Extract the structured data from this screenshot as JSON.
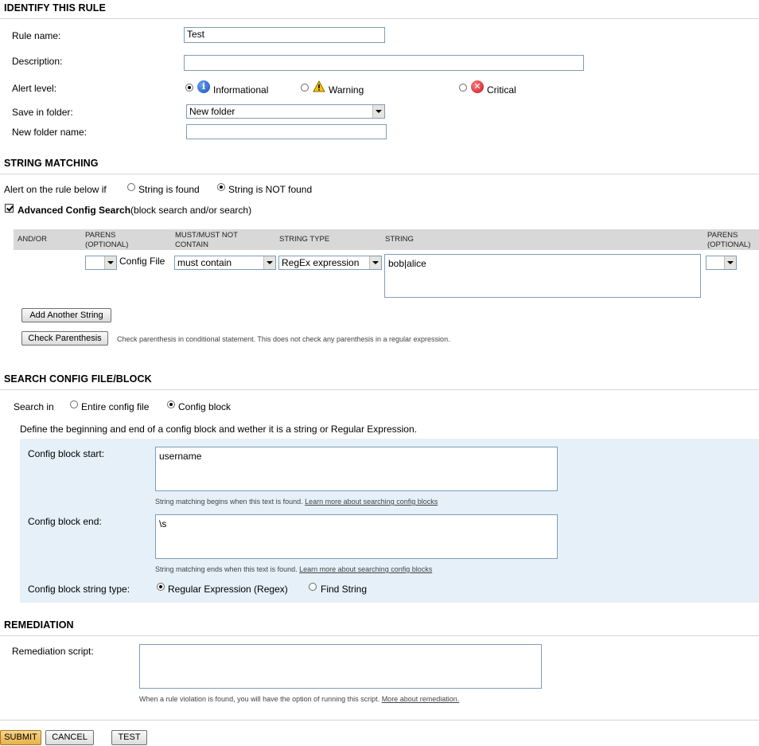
{
  "identify": {
    "title": "IDENTIFY THIS RULE",
    "rule_name_label": "Rule name:",
    "rule_name_value": "Test",
    "description_label": "Description:",
    "description_value": "",
    "alert_level_label": "Alert level:",
    "alert_options": [
      {
        "label": "Informational",
        "icon": "info-icon",
        "selected": true
      },
      {
        "label": "Warning",
        "icon": "warning-icon",
        "selected": false
      },
      {
        "label": "Critical",
        "icon": "critical-icon",
        "selected": false
      }
    ],
    "save_folder_label": "Save in folder:",
    "save_folder_value": "New folder",
    "new_folder_label": "New folder name:",
    "new_folder_value": ""
  },
  "string_matching": {
    "title": "STRING MATCHING",
    "alert_prefix": "Alert on the rule below if",
    "opt_found": "String is found",
    "opt_not_found": "String is NOT found",
    "selected": "not_found",
    "advanced_label": "Advanced Config Search",
    "advanced_suffix": "(block search and/or search)",
    "advanced_checked": true,
    "table": {
      "col_andor": "AND/OR",
      "col_parens1": "PARENS\n(OPTIONAL)",
      "col_must": "MUST/MUST NOT\nCONTAIN",
      "col_type": "STRING TYPE",
      "col_string": "STRING",
      "col_parens2": "PARENS\n(OPTIONAL)",
      "row": {
        "source": "Config File",
        "must": "must contain",
        "type": "RegEx expression",
        "string": "bob|alice"
      }
    },
    "add_string_btn": "Add Another String",
    "check_paren_btn": "Check Parenthesis",
    "check_paren_note": "Check parenthesis in conditional statement. This does not check any parenthesis in a regular expression."
  },
  "search_config": {
    "title": "SEARCH CONFIG FILE/BLOCK",
    "search_in_label": "Search in",
    "opt_entire": "Entire config file",
    "opt_block": "Config block",
    "selected": "block",
    "define_text": "Define the beginning and end of a config block and wether it is a string or Regular Expression.",
    "block_start_label": "Config block start:",
    "block_start_value": "username",
    "block_start_note": "String matching begins when this text is found.",
    "block_end_label": "Config block end:",
    "block_end_value": "\\s",
    "block_end_note": "String matching ends when this text is found.",
    "learn_more": "Learn more about searching config blocks",
    "string_type_label": "Config block string type:",
    "opt_regex": "Regular Expression (Regex)",
    "opt_find": "Find String",
    "string_type_selected": "regex"
  },
  "remediation": {
    "title": "REMEDIATION",
    "script_label": "Remediation script:",
    "script_value": "",
    "note": "When a rule violation is found, you will have the option of running this script.",
    "more_link": "More about remediation."
  },
  "footer": {
    "submit": "SUBMIT",
    "cancel": "CANCEL",
    "test": "TEST"
  },
  "colors": {
    "panel_bg": "#e5f0f8",
    "table_header_bg": "#d8d8d8",
    "submit_bg": "#f0c66a"
  }
}
